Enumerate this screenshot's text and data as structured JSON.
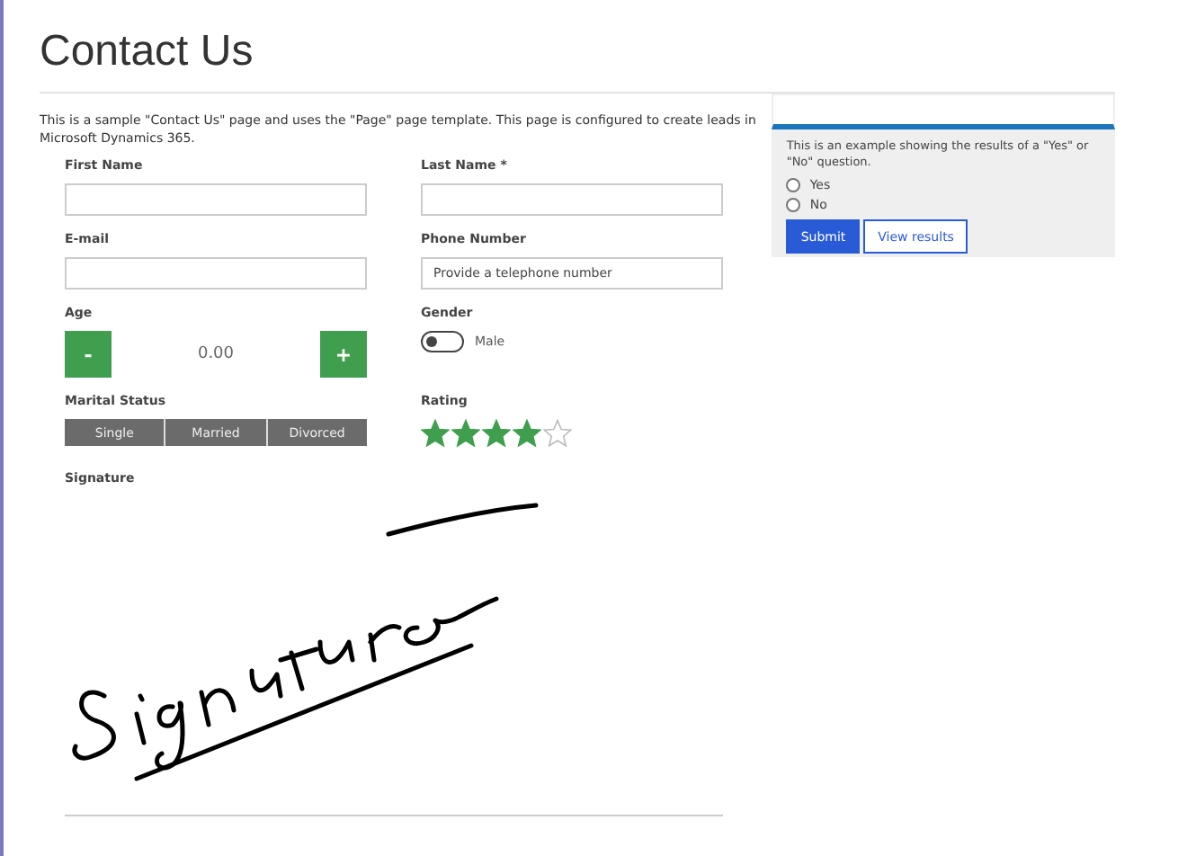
{
  "page": {
    "title": "Contact Us",
    "description": "This is a sample \"Contact Us\" page and uses the \"Page\" page template. This page is configured to create leads in Microsoft Dynamics 365."
  },
  "form": {
    "first_name": {
      "label": "First Name"
    },
    "last_name": {
      "label": "Last Name *"
    },
    "email": {
      "label": "E-mail"
    },
    "phone": {
      "label": "Phone Number",
      "placeholder": "Provide a telephone number"
    },
    "age": {
      "label": "Age",
      "minus": "-",
      "value": "0.00",
      "plus": "+"
    },
    "gender": {
      "label": "Gender",
      "on": false,
      "option": "Male"
    },
    "marital_status": {
      "label": "Marital Status",
      "options": [
        {
          "label": "Single",
          "selected": false
        },
        {
          "label": "Married",
          "selected": false
        },
        {
          "label": "Divorced",
          "selected": false
        }
      ]
    },
    "rating": {
      "label": "Rating",
      "stars": 4
    },
    "signature": {
      "label": "Signature"
    }
  },
  "poll": {
    "question": "This is an example showing the results of a \"Yes\" or \"No\" question.",
    "options": [
      {
        "label": "Yes",
        "selected": false
      },
      {
        "label": "No",
        "selected": false
      }
    ],
    "buttons": [
      {
        "label": "Submit",
        "kind": "primary"
      },
      {
        "label": "View results",
        "kind": "secondary"
      }
    ]
  }
}
